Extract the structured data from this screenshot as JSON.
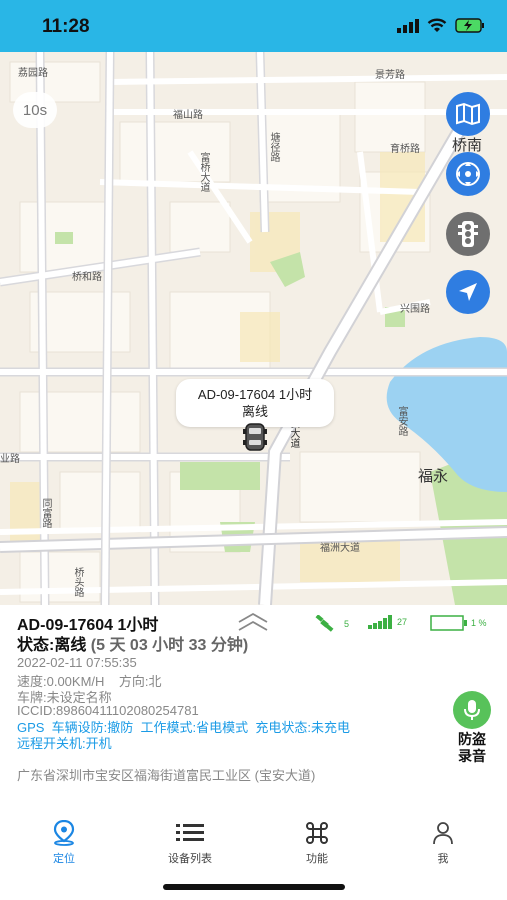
{
  "status_bar": {
    "time": "11:28"
  },
  "map": {
    "refresh_interval": "10s",
    "labels": {
      "a": "荔园路",
      "b": "福山路",
      "c": "富桥大道",
      "d": "桥和路",
      "e": "宝安大道",
      "f": "福洲大道",
      "g": "同富路",
      "h": "桥南",
      "i": "福永",
      "j": "育桥路",
      "k": "业路",
      "l": "桥头路",
      "m": "塘径路",
      "n": "景芳路",
      "o": "富安路",
      "p": "兴围路"
    },
    "car_popup": {
      "line1": "AD-09-17604 1小时",
      "line2": "离线"
    },
    "buttons": {
      "traffic_icon": "traffic-light-icon",
      "locate_icon": "navigation-arrow-icon"
    }
  },
  "device": {
    "title": "AD-09-17604 1小时",
    "status_label": "状态:离线",
    "status_duration": "(5 天 03 小时 33 分钟)",
    "gps_sat_count": "5",
    "signal_value": "27",
    "battery_percent": "1 %",
    "datetime": "2022-02-11 07:55:35",
    "speed_direction": "速度:0.00KM/H    方向:北",
    "plate": "车牌:未设定名称",
    "iccid": "ICCID:89860411102080254781",
    "gps_modes": "GPS  车辆设防:撤防  工作模式:省电模式  充电状态:未充电",
    "remote_power": "远程开关机:开机",
    "address": "广东省深圳市宝安区福海街道富民工业区 (宝安大道)",
    "anti_theft_label_1": "防盗",
    "anti_theft_label_2": "录音"
  },
  "tabs": [
    {
      "label": "定位",
      "icon": "location-pin-icon",
      "active": true
    },
    {
      "label": "设备列表",
      "icon": "list-icon",
      "active": false
    },
    {
      "label": "功能",
      "icon": "command-icon",
      "active": false
    },
    {
      "label": "我",
      "icon": "person-icon",
      "active": false
    }
  ],
  "colors": {
    "accent": "#29b6e6",
    "active_tab": "#1b86e3",
    "mic_green": "#58c25a",
    "info_blue": "#1b9be6"
  }
}
